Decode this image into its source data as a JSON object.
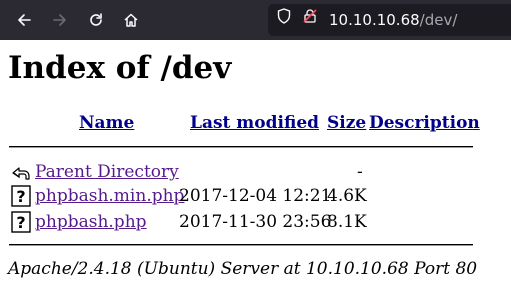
{
  "browser": {
    "url_host": "10.10.10.68",
    "url_path": "/dev/"
  },
  "page": {
    "title": "Index of /dev",
    "headers": {
      "name": "Name",
      "last_modified": "Last modified",
      "size": "Size",
      "description": "Description"
    },
    "rows": [
      {
        "icon": "back-icon",
        "name": "Parent Directory",
        "last_modified": "",
        "size": "-",
        "description": ""
      },
      {
        "icon": "unknown-file-icon",
        "name": "phpbash.min.php",
        "last_modified": "2017-12-04 12:21",
        "size": "4.6K",
        "description": ""
      },
      {
        "icon": "unknown-file-icon",
        "name": "phpbash.php",
        "last_modified": "2017-11-30 23:56",
        "size": "8.1K",
        "description": ""
      }
    ],
    "address": "Apache/2.4.18 (Ubuntu) Server at 10.10.10.68 Port 80"
  },
  "colors": {
    "toolbar_bg": "#2b2a33",
    "urlbar_bg": "#1c1b22",
    "visited_link": "#551a8b"
  }
}
